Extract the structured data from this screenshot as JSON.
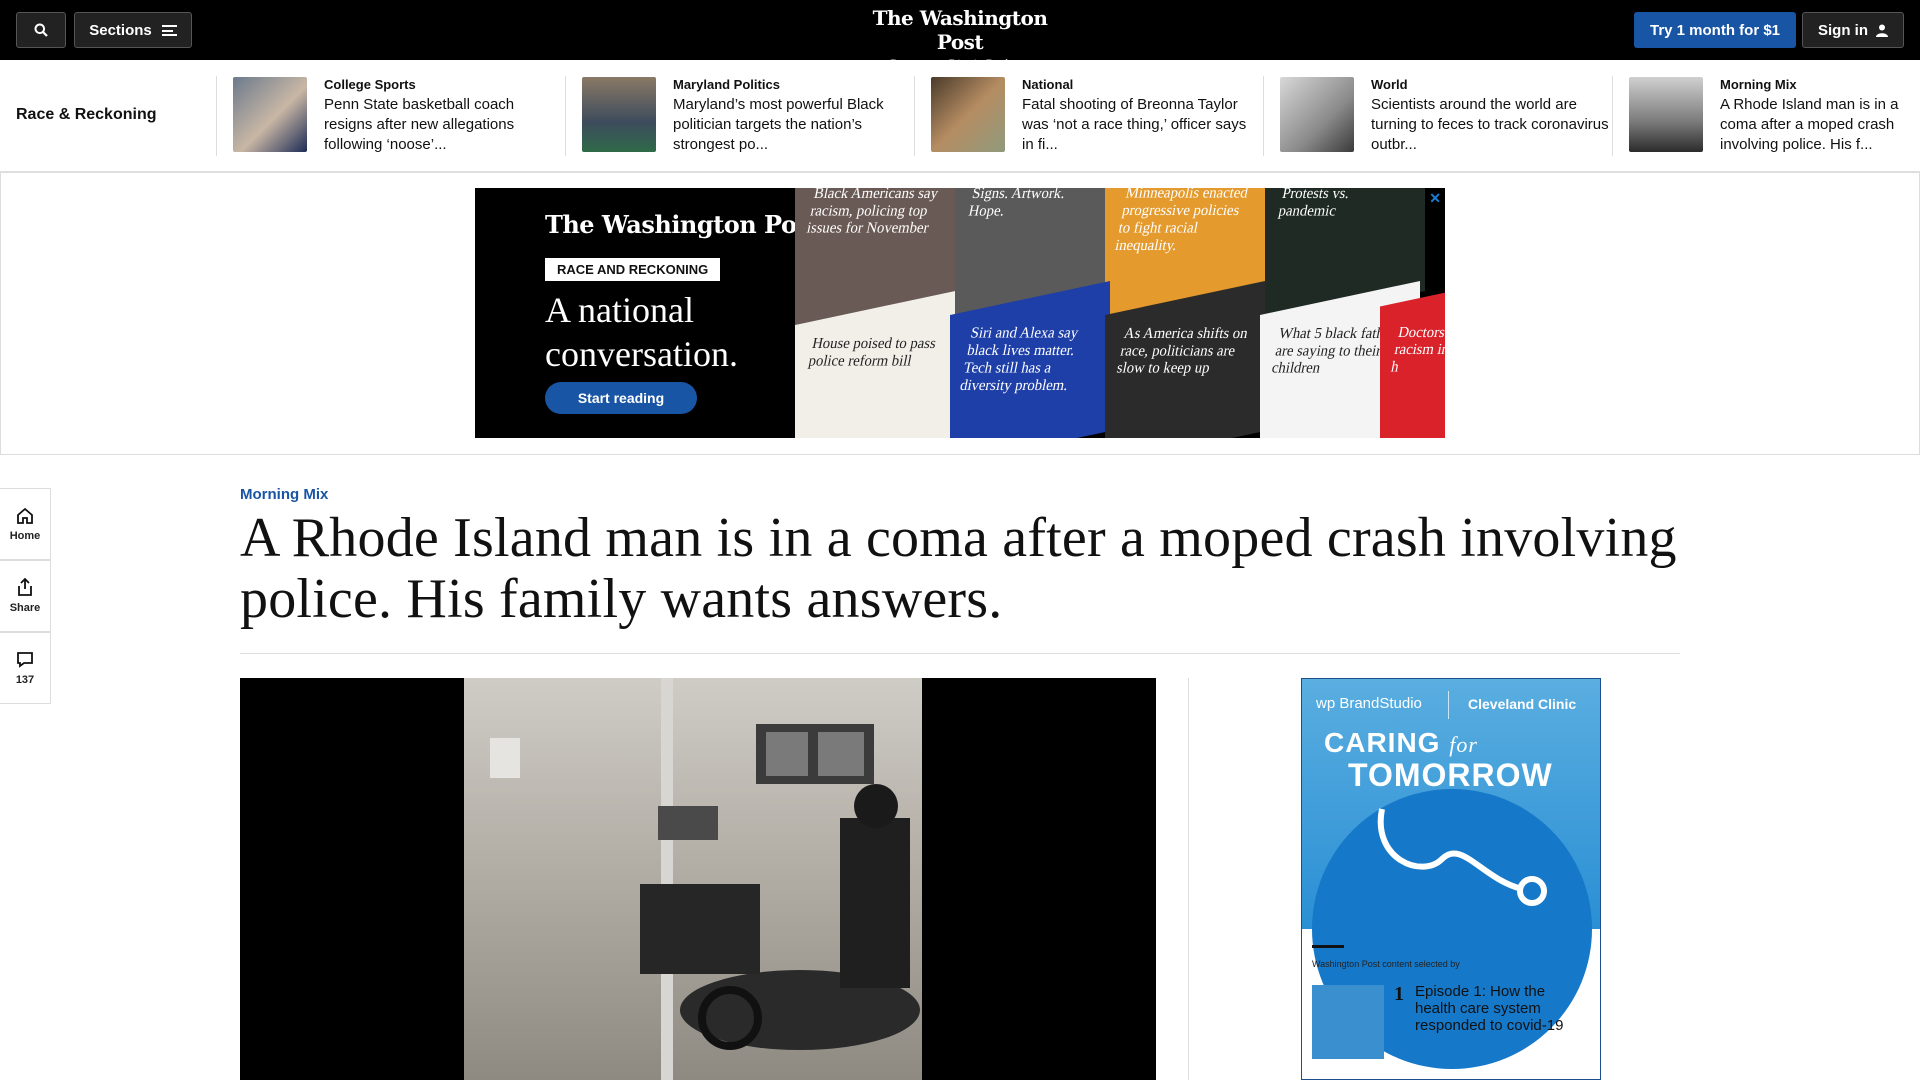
{
  "topbar": {
    "sections_label": "Sections",
    "logo_name": "The Washington Post",
    "logo_tagline": "Democracy Dies in Darkness",
    "try_label": "Try 1 month for $1",
    "signin_label": "Sign in"
  },
  "subnav": {
    "title": "Race & Reckoning",
    "stories": [
      {
        "kicker": "College Sports",
        "headline": "Penn State basketball coach resigns after new allegations following ‘noose’..."
      },
      {
        "kicker": "Maryland Politics",
        "headline": "Maryland’s most powerful Black politician targets the nation’s strongest po..."
      },
      {
        "kicker": "National",
        "headline": "Fatal shooting of Breonna Taylor was ‘not a race thing,’ officer says in fi..."
      },
      {
        "kicker": "World",
        "headline": "Scientists around the world are turning to feces to track coronavirus outbr..."
      },
      {
        "kicker": "Morning Mix",
        "headline": "A Rhode Island man is in a coma after a moped crash involving police. His f..."
      }
    ]
  },
  "ad_banner": {
    "logo": "The Washington Post",
    "tag": "RACE AND RECKONING",
    "headline": "A national conversation.",
    "button": "Start reading",
    "close": "✕",
    "tiles": [
      "Black Americans say racism, policing top issues for November",
      "Signs. Artwork. Hope.",
      "Minneapolis enacted progressive policies to fight racial inequality.",
      "Protests vs. pandemic",
      "House poised to pass police reform bill",
      "Siri and Alexa say black lives matter. Tech still has a diversity problem.",
      "As America shifts on race, politicians are slow to keep up",
      "What 5 black fathers are saying to their children",
      "Doctors racism in h"
    ]
  },
  "rail": {
    "home": "Home",
    "share": "Share",
    "comments": "137"
  },
  "article": {
    "kicker": "Morning Mix",
    "headline": "A Rhode Island man is in a coma after a moped crash involving police. His family wants answers."
  },
  "right_ad": {
    "brand": "wp BrandStudio",
    "clinic": "Cleveland Clinic",
    "caring": "CARING",
    "for": "for",
    "tomorrow": "TOMORROW",
    "selected_by": "Washington Post content selected by",
    "episode_num": "1",
    "episode_title": "Episode 1: How the health care system responded to covid-19"
  }
}
